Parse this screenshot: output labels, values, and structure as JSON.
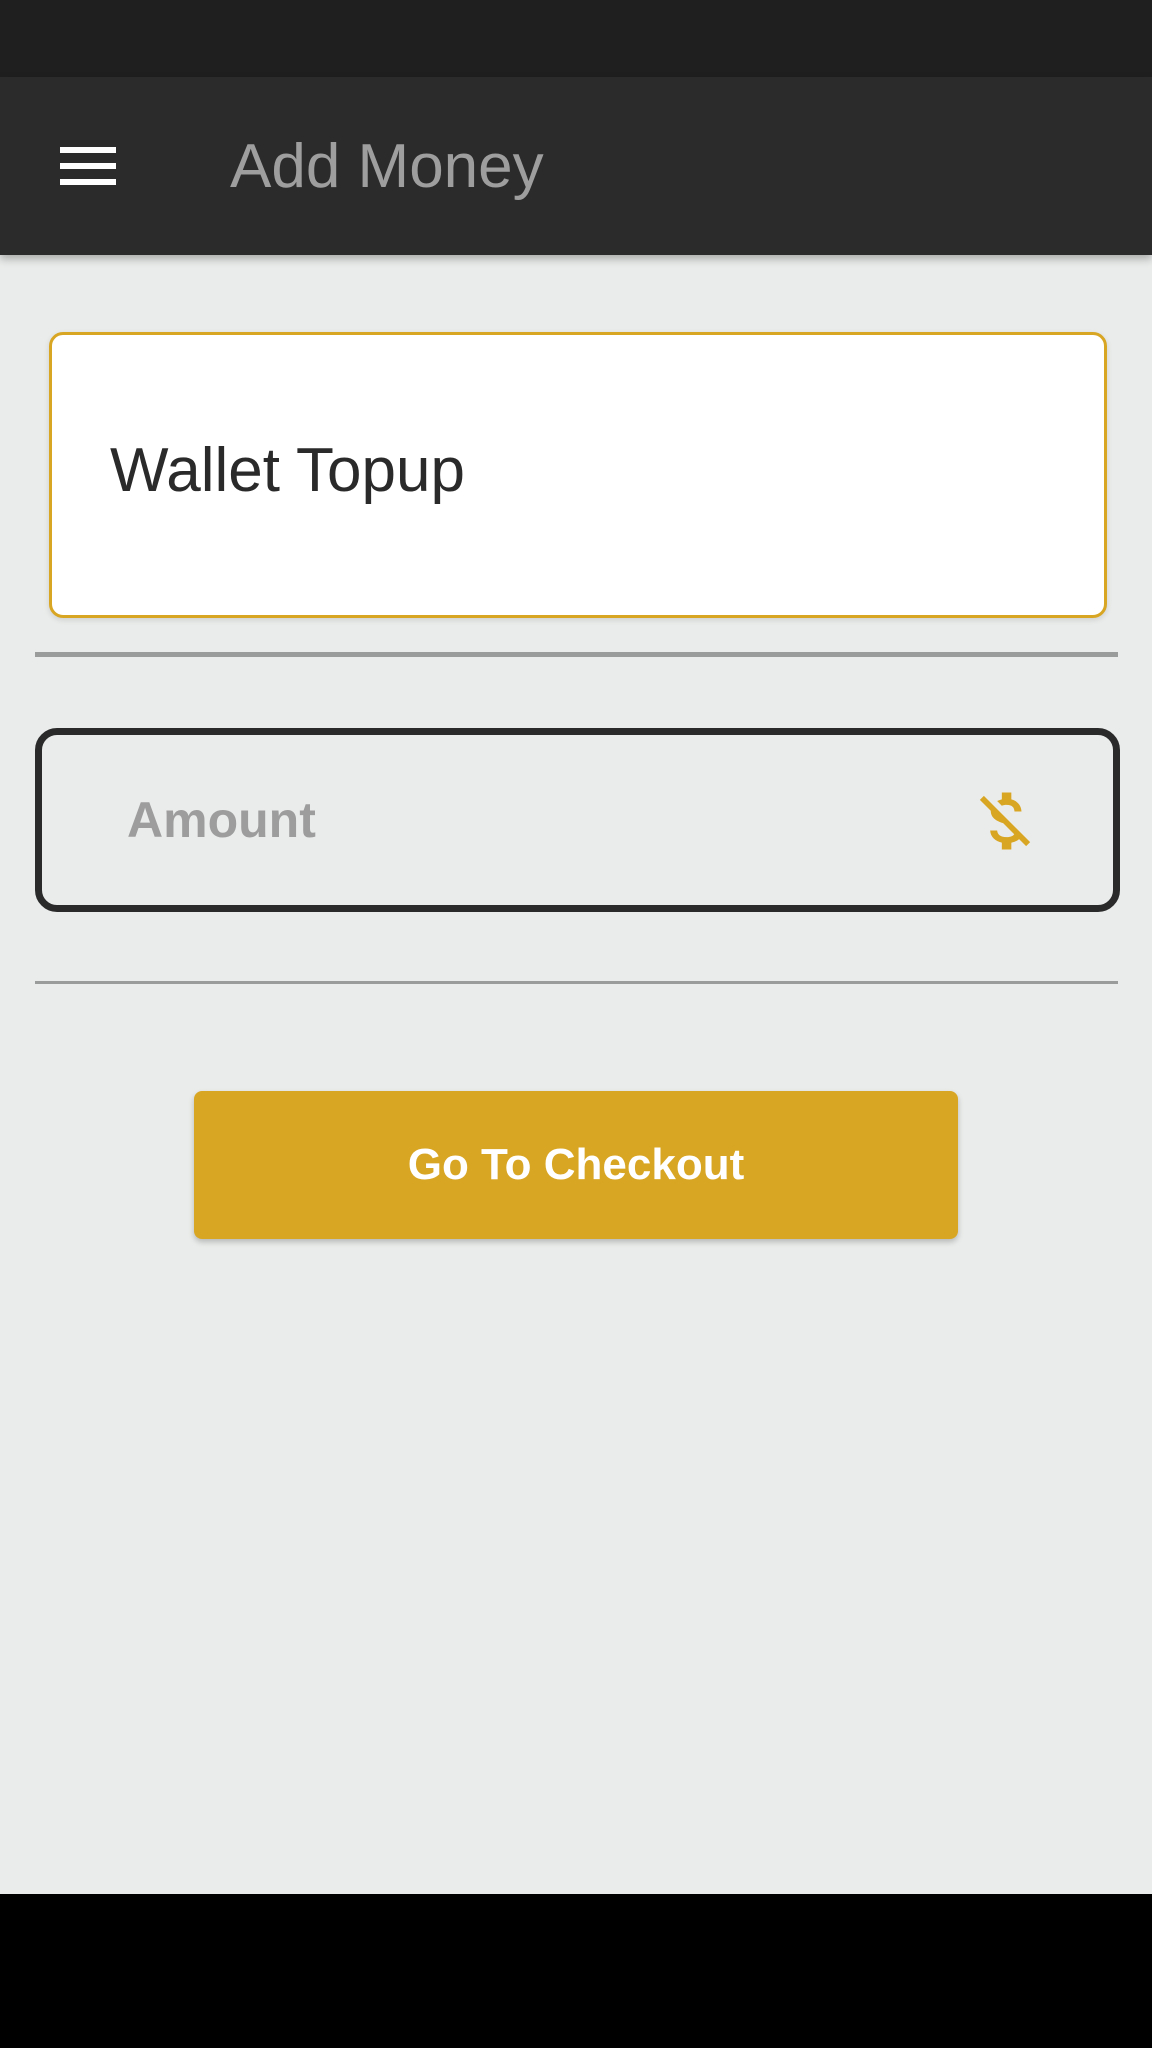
{
  "header": {
    "title": "Add Money",
    "menu_icon": "hamburger-menu-icon"
  },
  "title_card": {
    "value": "Wallet Topup"
  },
  "amount_field": {
    "placeholder": "Amount",
    "value": "",
    "icon": "dollar-off-icon"
  },
  "checkout_button": {
    "label": "Go To Checkout"
  },
  "colors": {
    "status_bar": "#1f1f1f",
    "app_bar": "#2b2b2b",
    "title_text": "#9e9e9e",
    "background": "#eaeceb",
    "accent": "#d9a624",
    "field_border": "#2a2a2a",
    "divider": "#9a9c9c",
    "nav_bar": "#000000"
  }
}
